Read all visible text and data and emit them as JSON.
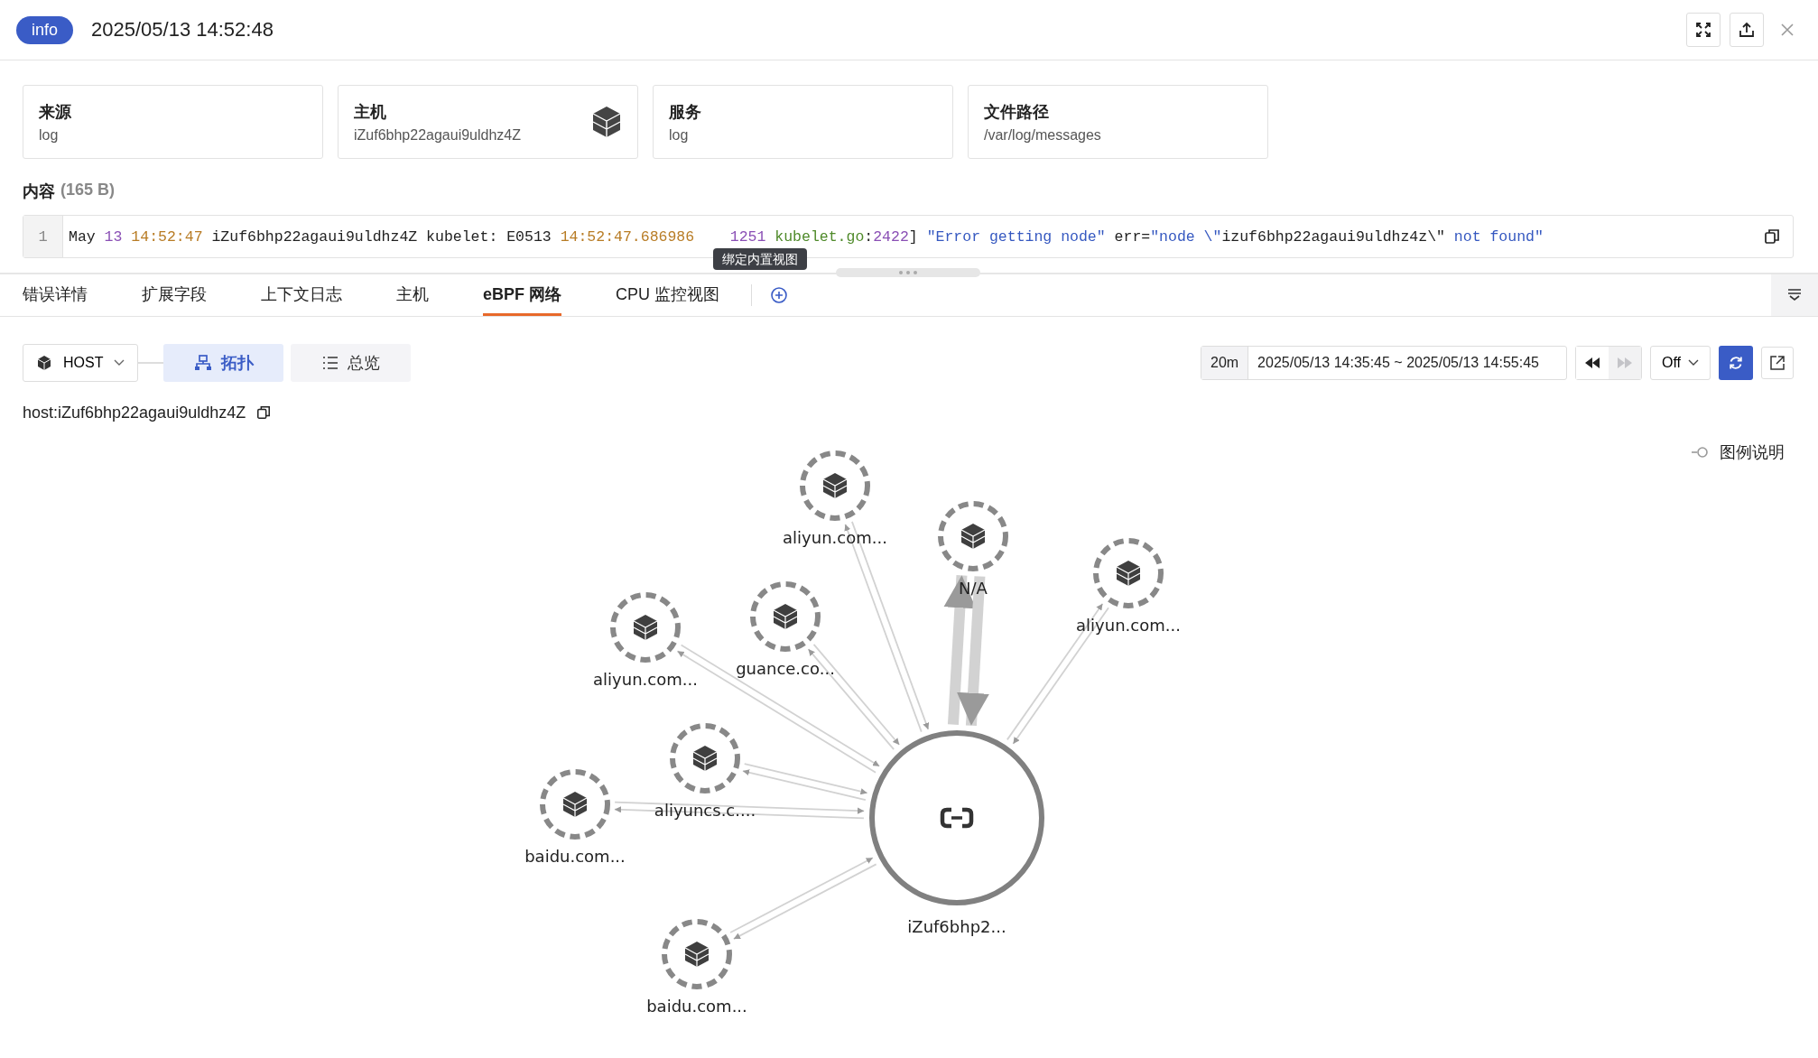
{
  "header": {
    "level": "info",
    "timestamp": "2025/05/13 14:52:48"
  },
  "cards": [
    {
      "label": "来源",
      "value": "log",
      "kind": "plain"
    },
    {
      "label": "主机",
      "value": "iZuf6bhp22agaui9uldhz4Z",
      "kind": "host"
    },
    {
      "label": "服务",
      "value": "log",
      "kind": "plain"
    },
    {
      "label": "文件路径",
      "value": "/var/log/messages",
      "kind": "plain"
    }
  ],
  "content": {
    "title": "内容",
    "size": "(165 B)",
    "line_number": "1",
    "segments": [
      {
        "text": "May ",
        "kind": "plain"
      },
      {
        "text": "13",
        "kind": "number"
      },
      {
        "text": " 14:52:47",
        "kind": "time"
      },
      {
        "text": " iZuf6bhp22agaui9uldhz4Z kubelet: E0513 ",
        "kind": "plain"
      },
      {
        "text": "14:52:47.686986",
        "kind": "time"
      },
      {
        "text": "    1251",
        "kind": "number"
      },
      {
        "text": " kubelet.go",
        "kind": "name"
      },
      {
        "text": ":",
        "kind": "plain"
      },
      {
        "text": "2422",
        "kind": "number"
      },
      {
        "text": "] ",
        "kind": "plain"
      },
      {
        "text": "\"Error getting node\"",
        "kind": "string"
      },
      {
        "text": " err=",
        "kind": "plain"
      },
      {
        "text": "\"node \\\"",
        "kind": "string"
      },
      {
        "text": "izuf6bhp22agaui9uldhz4z\\\"",
        "kind": "plain"
      },
      {
        "text": " not found\"",
        "kind": "string"
      }
    ]
  },
  "tooltip": "绑定内置视图",
  "tabs": [
    {
      "label": "错误详情",
      "selected": false
    },
    {
      "label": "扩展字段",
      "selected": false
    },
    {
      "label": "上下文日志",
      "selected": false
    },
    {
      "label": "主机",
      "selected": false
    },
    {
      "label": "eBPF 网络",
      "selected": true
    },
    {
      "label": "CPU 监控视图",
      "selected": false
    }
  ],
  "toolbar": {
    "scope": "HOST",
    "views": [
      {
        "label": "拓扑",
        "kind": "topology",
        "selected": true
      },
      {
        "label": "总览",
        "kind": "overview",
        "selected": false
      }
    ],
    "range_preset": "20m",
    "range": "2025/05/13 14:35:45 ~ 2025/05/13 14:55:45",
    "back_disabled": false,
    "forward_disabled": true,
    "refresh": "Off"
  },
  "host_label": "host:iZuf6bhp22agaui9uldhz4Z",
  "legend": "图例说明",
  "graph": {
    "center": {
      "label": "iZuf6bhp2..."
    },
    "peers": [
      {
        "label": "aliyun.com...",
        "heavy_traffic": false
      },
      {
        "label": "N/A",
        "heavy_traffic": true
      },
      {
        "label": "aliyun.com...",
        "heavy_traffic": false
      },
      {
        "label": "aliyun.com...",
        "heavy_traffic": false
      },
      {
        "label": "guance.co...",
        "heavy_traffic": false
      },
      {
        "label": "aliyuncs.c....",
        "heavy_traffic": false
      },
      {
        "label": "baidu.com...",
        "heavy_traffic": false
      },
      {
        "label": "baidu.com...",
        "heavy_traffic": false
      }
    ]
  }
}
